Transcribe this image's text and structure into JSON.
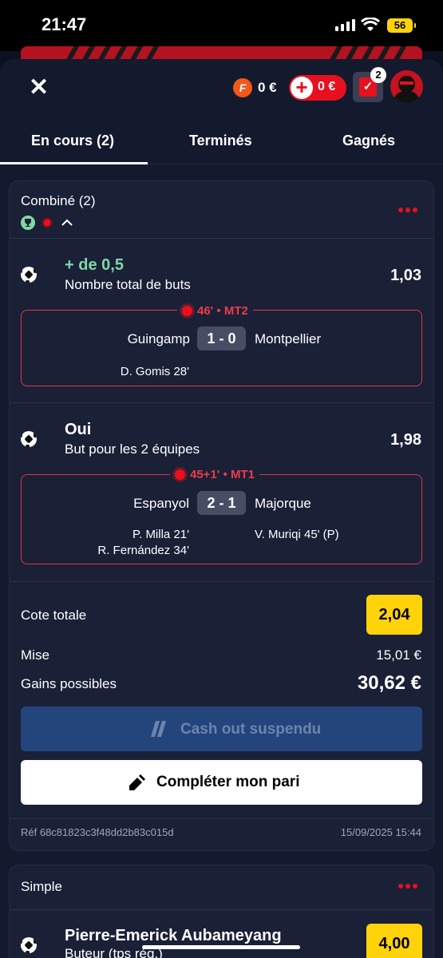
{
  "status_bar": {
    "time": "21:47",
    "battery": "56"
  },
  "header": {
    "close": "✕",
    "coin_letter": "F",
    "coin_balance": "0 €",
    "bonus_plus": "+",
    "bonus_balance": "0 €",
    "slip_count": "2",
    "slip_check": "✓"
  },
  "tabs": [
    {
      "label": "En cours (2)",
      "active": true
    },
    {
      "label": "Terminés"
    },
    {
      "label": "Gagnés"
    }
  ],
  "combined_bet": {
    "title": "Combiné (2)",
    "selections": [
      {
        "pick": "+ de 0,5",
        "market": "Nombre total de buts",
        "odds": "1,03",
        "live_status": "46' • MT2",
        "home_team": "Guingamp",
        "score": "1 - 0",
        "away_team": "Montpellier",
        "home_scorers": [
          "D. Gomis 28'"
        ],
        "away_scorers": []
      },
      {
        "pick": "Oui",
        "market": "But pour les 2 équipes",
        "odds": "1,98",
        "live_status": "45+1' • MT1",
        "home_team": "Espanyol",
        "score": "2 - 1",
        "away_team": "Majorque",
        "home_scorers": [
          "P. Milla 21'",
          "R. Fernández 34'"
        ],
        "away_scorers": [
          "V. Muriqi 45' (P)"
        ]
      }
    ],
    "total_odds_label": "Cote totale",
    "total_odds": "2,04",
    "stake_label": "Mise",
    "stake": "15,01 €",
    "potential_win_label": "Gains possibles",
    "potential_win": "30,62 €",
    "cashout_label": "Cash out suspendu",
    "complete_label": "Compléter mon pari",
    "reference": "Réf 68c81823c3f48dd2b83c015d",
    "date": "15/09/2025 15:44"
  },
  "single_bet": {
    "title": "Simple",
    "player": "Pierre-Emerick Aubameyang",
    "market": "Buteur (tps rég.)",
    "odds": "4,00"
  },
  "colors": {
    "accent_red": "#e8101f",
    "odds_yellow": "#ffd30a",
    "pick_green": "#7fd9a4",
    "card_bg": "#1a2036"
  }
}
